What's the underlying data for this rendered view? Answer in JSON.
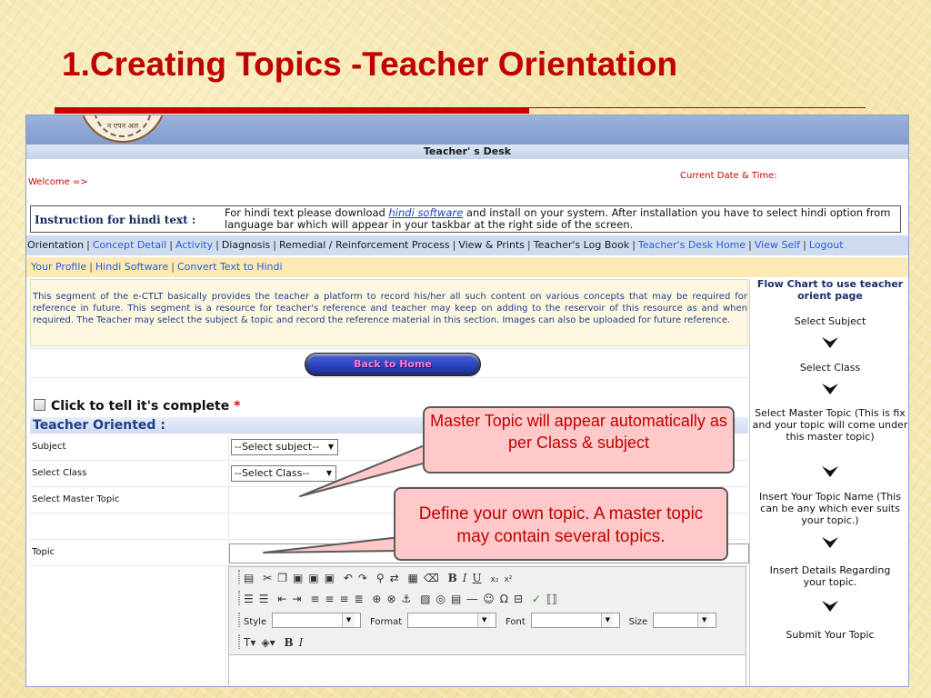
{
  "slide": {
    "title": "1.Creating Topics -Teacher Orientation"
  },
  "window": {
    "banner_emblem_text": "न एपन अल",
    "desk_title": "Teacher' s Desk",
    "welcome": "Welcome =>",
    "datetime_label": "Current Date & Time:",
    "hindi": {
      "label": "Instruction for hindi text :",
      "text_before": "For hindi text please download ",
      "link": "hindi software",
      "text_after": " and install on your system. After installation you have to select hindi option from language bar which will appear in your taskbar at the right side of the screen."
    },
    "nav": {
      "items": [
        "Orientation",
        "Concept Detail",
        "Activity",
        "Diagnosis",
        "Remedial / Reinforcement Process",
        "View & Prints",
        "Teacher's Log Book",
        "Teacher's Desk Home",
        "View Self",
        "Logout"
      ]
    },
    "subnav": {
      "items": [
        "Your Profile",
        "Hindi Software",
        "Convert Text to Hindi"
      ]
    },
    "description": "This segment of the e-CTLT basically provides the teacher a platform to record his/her all such content on various concepts that may be required for reference in future. This segment is a resource for teacher's reference and teacher may keep on adding to the reservoir of this resource as and when required. The Teacher may select the subject & topic and record the reference material in this section. Images can also be uploaded for future reference.",
    "back_button": "Back to Home",
    "complete_label": "Click to tell it's complete",
    "required_mark": "*",
    "section_title": "Teacher Oriented :",
    "form": {
      "subject_label": "Subject",
      "subject_value": "--Select subject--",
      "class_label": "Select Class",
      "class_value": "--Select Class--",
      "master_topic_label": "Select Master Topic",
      "topic_label": "Topic"
    },
    "editor": {
      "style_label": "Style",
      "format_label": "Format",
      "font_label": "Font",
      "size_label": "Size"
    }
  },
  "flow_chart": {
    "title": "Flow Chart to use teacher orient page",
    "steps": [
      "Select Subject",
      "Select Class",
      "Select Master Topic (This is fix and your topic will come under this master topic)",
      "Insert Your Topic Name (This can be any which ever suits your topic.)",
      "Insert Details Regarding your topic.",
      "Submit Your Topic"
    ]
  },
  "callouts": {
    "master_topic": "Master Topic will appear automatically as per Class & subject",
    "define_topic": "Define your own topic. A master topic may contain several topics."
  },
  "colors": {
    "title_red": "#c00000",
    "callout_fill": "#ffc9c9",
    "link_blue": "#2a5bd7"
  }
}
